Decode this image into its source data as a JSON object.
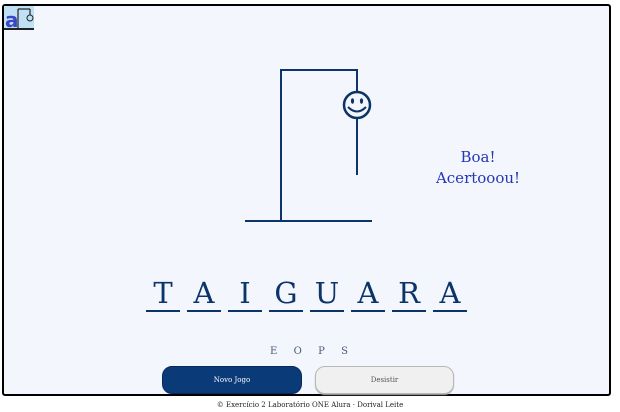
{
  "app": {
    "logo_text": "a"
  },
  "message": {
    "line1": "Boa!",
    "line2": "Acertooou!"
  },
  "word": {
    "letters": [
      "T",
      "A",
      "I",
      "G",
      "U",
      "A",
      "R",
      "A"
    ]
  },
  "wrong_letters": [
    "E",
    "O",
    "P",
    "S"
  ],
  "buttons": {
    "new_game": "Novo Jogo",
    "give_up": "Desistir"
  },
  "footer": {
    "text": "© Exercício 2 Laboratório ONE Alura · Dorival Leite"
  },
  "colors": {
    "primary": "#0a3a78",
    "message": "#2436b8",
    "background": "#f3f6fc"
  }
}
